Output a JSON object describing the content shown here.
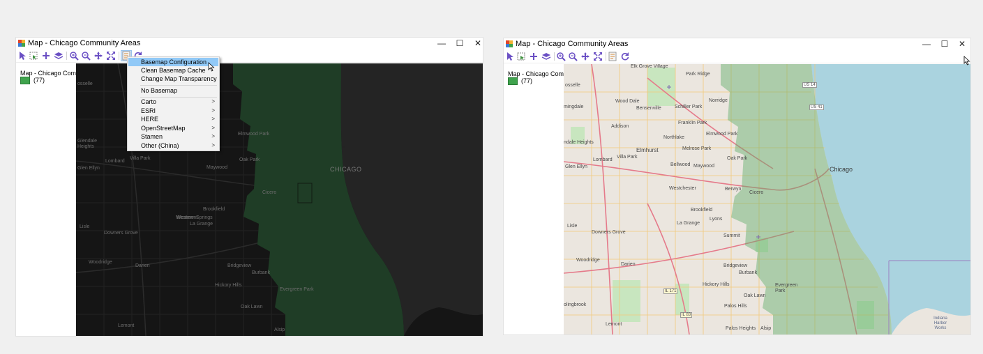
{
  "windows": [
    {
      "title": "Map - Chicago Community Areas",
      "legend": {
        "layer_name": "Map - Chicago Community A",
        "count": "(77)"
      },
      "toolbar": [
        "select-arrow-icon",
        "select-rect-icon",
        "add-icon",
        "layers-icon",
        "zoom-in-icon",
        "zoom-out-icon",
        "pan-icon",
        "full-extent-icon",
        "basemap-icon",
        "refresh-icon"
      ],
      "basemap_style": "dark",
      "map_labels": [
        "osselle",
        "Glendale Heights",
        "Glen Ellyn",
        "Lombard",
        "Villa Park",
        "Elmwood Park",
        "Oak Park",
        "Maywood",
        "Cicero",
        "Brookfield",
        "Lisle",
        "Downers Grove",
        "Westmont",
        "Woodridge",
        "Darien",
        "Hickory Hills",
        "Bridgeview",
        "Burbank",
        "Evergreen Park",
        "Oak Lawn",
        "Lemont",
        "Alsip",
        "CHICAGO",
        "Western Springs",
        "La Grange"
      ]
    },
    {
      "title": "Map - Chicago Community Areas",
      "legend": {
        "layer_name": "Map - Chicago Community A",
        "count": "(77)"
      },
      "basemap_style": "light",
      "map_labels": [
        "Elk Grove Village",
        "Park Ridge",
        "osselle",
        "Wood Dale",
        "Bensenville",
        "Schiller Park",
        "Norridge",
        "Addison",
        "Franklin Park",
        "mingdale",
        "Elmwood Park",
        "Northlake",
        "ndale Heights",
        "Elmhurst",
        "Melrose Park",
        "Oak Park",
        "Bellwood",
        "Maywood",
        "Lombard",
        "Villa Park",
        "Glen Ellyn",
        "Chicago",
        "Westchester",
        "Berwyn",
        "Cicero",
        "Brookfield",
        "Lyons",
        "La Grange",
        "Lisle",
        "Summit",
        "Downers Grove",
        "Woodridge",
        "Darien",
        "Bridgeview",
        "Burbank",
        "Hickory Hills",
        "Evergreen Park",
        "Oak Lawn",
        "Palos Hills",
        "Lemont",
        "Palos Heights",
        "Alsip",
        "olingbrook",
        "US 14",
        "US 41",
        "IL 171",
        "IL 83",
        "Indiana Harbor Works"
      ]
    }
  ],
  "dropdown_menu": {
    "items": [
      "Basemap Configuration",
      "Clean Basemap Cache",
      "Change Map Transparency",
      "No Basemap",
      "Carto",
      "ESRI",
      "HERE",
      "OpenStreetMap",
      "Stamen",
      "Other (China)"
    ],
    "highlighted": "Basemap Configuration",
    "submenu_arrow": ">"
  },
  "window_buttons": {
    "minimize": "—",
    "maximize": "☐",
    "close": "✕"
  },
  "colors": {
    "accent_green": "#3fa34d",
    "menu_highlight": "#91c9f7",
    "dark_map": "#161616",
    "water": "#aad3df"
  }
}
